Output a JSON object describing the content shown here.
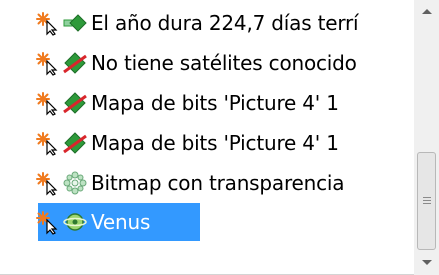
{
  "tree": {
    "items": [
      {
        "label": "El año dura 224,7 días terrí",
        "icon": "green-diamond-arrow-icon"
      },
      {
        "label": "No tiene satélites conocido",
        "icon": "struck-diamond-icon"
      },
      {
        "label": "Mapa de bits 'Picture 4' 1",
        "icon": "struck-diamond-icon"
      },
      {
        "label": "Mapa de bits 'Picture 4' 1",
        "icon": "struck-diamond-icon"
      },
      {
        "label": "Bitmap con transparencia",
        "icon": "bitmap-icon"
      },
      {
        "label": "Venus",
        "icon": "planet-icon",
        "selected": true
      }
    ]
  },
  "colors": {
    "selection": "#3399ff",
    "wand": "#f07a1e",
    "diamond": "#2e9a3a",
    "strike": "#d9262c"
  }
}
